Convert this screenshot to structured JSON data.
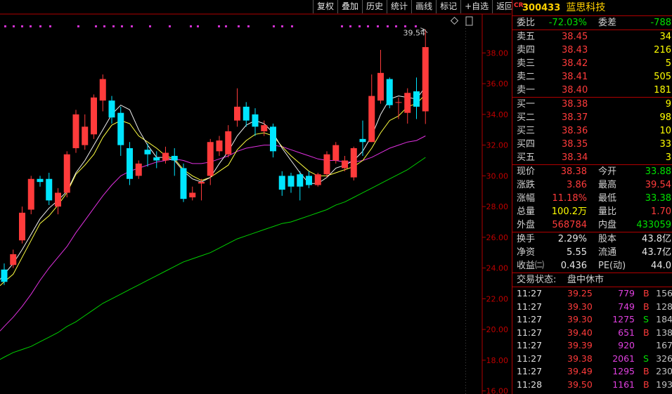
{
  "toolbar": {
    "buttons": [
      "复权",
      "叠加",
      "历史",
      "统计",
      "画线",
      "标记",
      "+自选",
      "返回"
    ]
  },
  "chart_data": {
    "type": "candlestick",
    "y_ticks": [
      "38.00",
      "36.00",
      "34.00",
      "32.00",
      "30.00",
      "28.00",
      "26.00",
      "24.00",
      "22.00",
      "20.00",
      "18.00",
      "16.00"
    ],
    "ylim": [
      15.8,
      39.8
    ],
    "annotation": "39.54",
    "candles": [
      {
        "o": 23.9,
        "c": 23.1,
        "h": 24.3,
        "l": 22.9
      },
      {
        "o": 24.2,
        "c": 24.9,
        "h": 25.2,
        "l": 24.0
      },
      {
        "o": 25.8,
        "c": 27.6,
        "h": 28.0,
        "l": 25.6
      },
      {
        "o": 27.8,
        "c": 29.8,
        "h": 30.0,
        "l": 27.5
      },
      {
        "o": 29.8,
        "c": 29.6,
        "h": 30.0,
        "l": 29.3
      },
      {
        "o": 29.8,
        "c": 28.4,
        "h": 30.2,
        "l": 28.1
      },
      {
        "o": 28.0,
        "c": 28.9,
        "h": 29.2,
        "l": 27.5
      },
      {
        "o": 28.9,
        "c": 31.4,
        "h": 31.6,
        "l": 28.6
      },
      {
        "o": 31.8,
        "c": 34.0,
        "h": 34.3,
        "l": 31.5
      },
      {
        "o": 32.0,
        "c": 33.2,
        "h": 34.0,
        "l": 31.7
      },
      {
        "o": 32.7,
        "c": 35.1,
        "h": 35.3,
        "l": 32.4
      },
      {
        "o": 34.9,
        "c": 36.3,
        "h": 36.6,
        "l": 34.2
      },
      {
        "o": 34.9,
        "c": 33.8,
        "h": 35.2,
        "l": 33.4
      },
      {
        "o": 34.1,
        "c": 32.0,
        "h": 34.5,
        "l": 31.3
      },
      {
        "o": 31.8,
        "c": 29.8,
        "h": 32.2,
        "l": 29.4
      },
      {
        "o": 30.0,
        "c": 30.8,
        "h": 31.0,
        "l": 29.8
      },
      {
        "o": 31.7,
        "c": 31.4,
        "h": 32.1,
        "l": 30.6
      },
      {
        "o": 31.2,
        "c": 31.0,
        "h": 31.6,
        "l": 30.5
      },
      {
        "o": 31.0,
        "c": 31.5,
        "h": 31.9,
        "l": 30.8
      },
      {
        "o": 31.3,
        "c": 31.0,
        "h": 31.8,
        "l": 30.0
      },
      {
        "o": 30.5,
        "c": 28.5,
        "h": 30.8,
        "l": 28.3
      },
      {
        "o": 28.6,
        "c": 28.9,
        "h": 29.3,
        "l": 28.4
      },
      {
        "o": 29.5,
        "c": 29.6,
        "h": 29.8,
        "l": 28.4
      },
      {
        "o": 30.0,
        "c": 32.2,
        "h": 32.4,
        "l": 29.4
      },
      {
        "o": 31.6,
        "c": 32.3,
        "h": 32.6,
        "l": 31.3
      },
      {
        "o": 31.4,
        "c": 32.9,
        "h": 33.3,
        "l": 31.2
      },
      {
        "o": 33.6,
        "c": 34.5,
        "h": 35.7,
        "l": 33.2
      },
      {
        "o": 34.5,
        "c": 33.6,
        "h": 34.8,
        "l": 33.2
      },
      {
        "o": 34.0,
        "c": 33.2,
        "h": 34.4,
        "l": 32.6
      },
      {
        "o": 32.9,
        "c": 33.3,
        "h": 33.6,
        "l": 32.6
      },
      {
        "o": 33.2,
        "c": 31.6,
        "h": 33.4,
        "l": 31.2
      },
      {
        "o": 30.0,
        "c": 29.1,
        "h": 30.3,
        "l": 28.7
      },
      {
        "o": 30.0,
        "c": 29.3,
        "h": 30.2,
        "l": 28.9
      },
      {
        "o": 30.1,
        "c": 29.3,
        "h": 30.3,
        "l": 28.4
      },
      {
        "o": 30.0,
        "c": 29.4,
        "h": 30.3,
        "l": 29.2
      },
      {
        "o": 29.4,
        "c": 30.1,
        "h": 30.2,
        "l": 29.3
      },
      {
        "o": 30.1,
        "c": 31.4,
        "h": 31.6,
        "l": 29.9
      },
      {
        "o": 31.0,
        "c": 32.0,
        "h": 32.2,
        "l": 30.8
      },
      {
        "o": 30.5,
        "c": 31.0,
        "h": 31.3,
        "l": 30.3
      },
      {
        "o": 29.9,
        "c": 31.8,
        "h": 31.9,
        "l": 29.7
      },
      {
        "o": 32.4,
        "c": 32.2,
        "h": 33.6,
        "l": 31.3
      },
      {
        "o": 32.2,
        "c": 35.2,
        "h": 36.6,
        "l": 32.2
      },
      {
        "o": 34.9,
        "c": 36.7,
        "h": 38.2,
        "l": 34.7
      },
      {
        "o": 36.3,
        "c": 34.6,
        "h": 36.4,
        "l": 34.4
      },
      {
        "o": 34.8,
        "c": 34.8,
        "h": 35.1,
        "l": 33.7
      },
      {
        "o": 34.1,
        "c": 35.4,
        "h": 35.7,
        "l": 33.4
      },
      {
        "o": 35.5,
        "c": 34.5,
        "h": 36.4,
        "l": 33.7
      },
      {
        "o": 34.2,
        "c": 38.38,
        "h": 39.54,
        "l": 33.38
      }
    ],
    "ma_yellow": [
      23.1,
      23.6,
      24.7,
      25.8,
      26.9,
      27.4,
      28.1,
      28.9,
      30.1,
      30.7,
      31.4,
      32.5,
      33.3,
      33.6,
      33.4,
      32.6,
      32.2,
      31.8,
      31.3,
      31.1,
      30.4,
      30.0,
      29.7,
      29.9,
      30.3,
      30.7,
      31.7,
      32.3,
      32.7,
      32.8,
      32.6,
      31.9,
      31.3,
      30.8,
      30.3,
      30.0,
      30.0,
      30.2,
      30.4,
      30.6,
      31.0,
      31.8,
      32.8,
      33.6,
      33.9,
      34.5,
      34.7,
      35.3
    ],
    "ma_white": [
      23.6,
      24.3,
      25.2,
      26.2,
      27.2,
      27.9,
      28.4,
      29.0,
      30.2,
      31.0,
      32.0,
      33.0,
      34.0,
      34.6,
      34.3,
      33.0,
      32.0,
      31.2,
      31.2,
      31.0,
      30.3,
      29.8,
      29.6,
      29.9,
      30.8,
      31.6,
      32.6,
      33.3,
      33.6,
      33.4,
      32.8,
      31.8,
      31.0,
      30.2,
      29.5,
      29.5,
      29.9,
      30.5,
      30.7,
      31.0,
      31.6,
      32.6,
      34.0,
      35.0,
      35.2,
      35.1,
      35.0,
      35.8
    ],
    "ma_magenta": [
      20.2,
      20.8,
      21.5,
      22.3,
      23.2,
      24.0,
      24.7,
      25.4,
      26.3,
      27.1,
      27.9,
      28.7,
      29.4,
      30.0,
      30.3,
      30.5,
      30.7,
      30.9,
      31.0,
      31.1,
      31.0,
      30.8,
      30.8,
      30.9,
      31.1,
      31.3,
      31.6,
      31.8,
      31.9,
      32.0,
      32.0,
      31.9,
      31.7,
      31.5,
      31.3,
      31.1,
      31.0,
      31.0,
      30.9,
      30.9,
      31.0,
      31.2,
      31.5,
      31.8,
      32.0,
      32.2,
      32.3,
      32.6
    ],
    "ma_green": [
      18.2,
      18.5,
      18.7,
      18.9,
      19.2,
      19.5,
      19.8,
      20.2,
      20.5,
      20.9,
      21.3,
      21.7,
      22.0,
      22.3,
      22.6,
      22.9,
      23.2,
      23.5,
      23.8,
      24.1,
      24.4,
      24.6,
      24.8,
      25.0,
      25.3,
      25.6,
      25.9,
      26.1,
      26.3,
      26.5,
      26.7,
      26.9,
      27.0,
      27.2,
      27.4,
      27.6,
      27.8,
      28.1,
      28.3,
      28.6,
      28.9,
      29.2,
      29.5,
      29.8,
      30.1,
      30.4,
      30.8,
      31.2
    ]
  },
  "header": {
    "market_tag": "CR",
    "code": "300433",
    "name": "蓝思科技"
  },
  "commit": {
    "wb_label": "委比",
    "wb_value": "-72.03%",
    "wc_label": "委差",
    "wc_value": "-788"
  },
  "asks": [
    {
      "label": "卖五",
      "price": "38.45",
      "vol": "34"
    },
    {
      "label": "卖四",
      "price": "38.43",
      "vol": "216"
    },
    {
      "label": "卖三",
      "price": "38.42",
      "vol": "5"
    },
    {
      "label": "卖二",
      "price": "38.41",
      "vol": "505"
    },
    {
      "label": "卖一",
      "price": "38.40",
      "vol": "181"
    }
  ],
  "bids": [
    {
      "label": "买一",
      "price": "38.38",
      "vol": "9"
    },
    {
      "label": "买二",
      "price": "38.37",
      "vol": "98"
    },
    {
      "label": "买三",
      "price": "38.36",
      "vol": "10"
    },
    {
      "label": "买四",
      "price": "38.35",
      "vol": "33"
    },
    {
      "label": "买五",
      "price": "38.34",
      "vol": "3"
    }
  ],
  "quote": [
    {
      "l": "现价",
      "v": "38.38",
      "vc": "red",
      "l2": "今开",
      "v2": "33.88",
      "v2c": "green"
    },
    {
      "l": "涨跌",
      "v": "3.86",
      "vc": "red",
      "l2": "最高",
      "v2": "39.54",
      "v2c": "red"
    },
    {
      "l": "涨幅",
      "v": "11.18%",
      "vc": "red",
      "l2": "最低",
      "v2": "33.38",
      "v2c": "green"
    },
    {
      "l": "总量",
      "v": "100.2万",
      "vc": "yellow",
      "l2": "量比",
      "v2": "1.70",
      "v2c": "red"
    },
    {
      "l": "外盘",
      "v": "568784",
      "vc": "red",
      "l2": "内盘",
      "v2": "433059",
      "v2c": "green"
    }
  ],
  "stats": [
    {
      "l": "换手",
      "v": "2.29%",
      "l2": "股本",
      "v2": "43.8亿"
    },
    {
      "l": "净资",
      "v": "5.55",
      "l2": "流通",
      "v2": "43.7亿"
    },
    {
      "l": "收益㈡",
      "v": "0.436",
      "l2": "PE(动)",
      "v2": "44.0"
    }
  ],
  "status": {
    "label": "交易状态:",
    "value": "盘中休市"
  },
  "ticks": [
    {
      "t": "11:27",
      "p": "39.25",
      "v": "779",
      "bs": "B",
      "n": "156"
    },
    {
      "t": "11:27",
      "p": "39.30",
      "v": "749",
      "bs": "B",
      "n": "128"
    },
    {
      "t": "11:27",
      "p": "39.30",
      "v": "1275",
      "bs": "S",
      "n": "184"
    },
    {
      "t": "11:27",
      "p": "39.40",
      "v": "651",
      "bs": "B",
      "n": "138"
    },
    {
      "t": "11:27",
      "p": "39.39",
      "v": "920",
      "bs": "",
      "n": "167"
    },
    {
      "t": "11:27",
      "p": "39.38",
      "v": "2061",
      "bs": "S",
      "n": "326"
    },
    {
      "t": "11:27",
      "p": "39.49",
      "v": "1295",
      "bs": "B",
      "n": "230"
    },
    {
      "t": "11:28",
      "p": "39.50",
      "v": "1161",
      "bs": "B",
      "n": "193"
    }
  ],
  "colors": {
    "up": "#ff3b3b",
    "down": "#00e5ff",
    "ma_white": "#f0f0f0",
    "ma_yellow": "#ffff40",
    "ma_magenta": "#e030e0",
    "ma_green": "#00d000",
    "grid_red": "#b00000"
  }
}
